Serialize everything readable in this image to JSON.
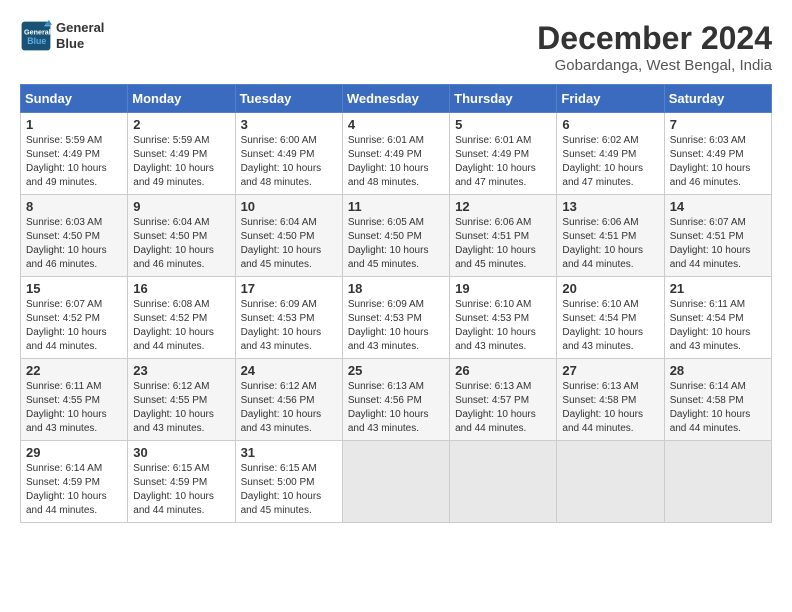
{
  "header": {
    "logo_line1": "General",
    "logo_line2": "Blue",
    "title": "December 2024",
    "location": "Gobardanga, West Bengal, India"
  },
  "weekdays": [
    "Sunday",
    "Monday",
    "Tuesday",
    "Wednesday",
    "Thursday",
    "Friday",
    "Saturday"
  ],
  "weeks": [
    [
      {
        "day": "1",
        "sunrise": "5:59 AM",
        "sunset": "4:49 PM",
        "daylight": "10 hours and 49 minutes."
      },
      {
        "day": "2",
        "sunrise": "5:59 AM",
        "sunset": "4:49 PM",
        "daylight": "10 hours and 49 minutes."
      },
      {
        "day": "3",
        "sunrise": "6:00 AM",
        "sunset": "4:49 PM",
        "daylight": "10 hours and 48 minutes."
      },
      {
        "day": "4",
        "sunrise": "6:01 AM",
        "sunset": "4:49 PM",
        "daylight": "10 hours and 48 minutes."
      },
      {
        "day": "5",
        "sunrise": "6:01 AM",
        "sunset": "4:49 PM",
        "daylight": "10 hours and 47 minutes."
      },
      {
        "day": "6",
        "sunrise": "6:02 AM",
        "sunset": "4:49 PM",
        "daylight": "10 hours and 47 minutes."
      },
      {
        "day": "7",
        "sunrise": "6:03 AM",
        "sunset": "4:49 PM",
        "daylight": "10 hours and 46 minutes."
      }
    ],
    [
      {
        "day": "8",
        "sunrise": "6:03 AM",
        "sunset": "4:50 PM",
        "daylight": "10 hours and 46 minutes."
      },
      {
        "day": "9",
        "sunrise": "6:04 AM",
        "sunset": "4:50 PM",
        "daylight": "10 hours and 46 minutes."
      },
      {
        "day": "10",
        "sunrise": "6:04 AM",
        "sunset": "4:50 PM",
        "daylight": "10 hours and 45 minutes."
      },
      {
        "day": "11",
        "sunrise": "6:05 AM",
        "sunset": "4:50 PM",
        "daylight": "10 hours and 45 minutes."
      },
      {
        "day": "12",
        "sunrise": "6:06 AM",
        "sunset": "4:51 PM",
        "daylight": "10 hours and 45 minutes."
      },
      {
        "day": "13",
        "sunrise": "6:06 AM",
        "sunset": "4:51 PM",
        "daylight": "10 hours and 44 minutes."
      },
      {
        "day": "14",
        "sunrise": "6:07 AM",
        "sunset": "4:51 PM",
        "daylight": "10 hours and 44 minutes."
      }
    ],
    [
      {
        "day": "15",
        "sunrise": "6:07 AM",
        "sunset": "4:52 PM",
        "daylight": "10 hours and 44 minutes."
      },
      {
        "day": "16",
        "sunrise": "6:08 AM",
        "sunset": "4:52 PM",
        "daylight": "10 hours and 44 minutes."
      },
      {
        "day": "17",
        "sunrise": "6:09 AM",
        "sunset": "4:53 PM",
        "daylight": "10 hours and 43 minutes."
      },
      {
        "day": "18",
        "sunrise": "6:09 AM",
        "sunset": "4:53 PM",
        "daylight": "10 hours and 43 minutes."
      },
      {
        "day": "19",
        "sunrise": "6:10 AM",
        "sunset": "4:53 PM",
        "daylight": "10 hours and 43 minutes."
      },
      {
        "day": "20",
        "sunrise": "6:10 AM",
        "sunset": "4:54 PM",
        "daylight": "10 hours and 43 minutes."
      },
      {
        "day": "21",
        "sunrise": "6:11 AM",
        "sunset": "4:54 PM",
        "daylight": "10 hours and 43 minutes."
      }
    ],
    [
      {
        "day": "22",
        "sunrise": "6:11 AM",
        "sunset": "4:55 PM",
        "daylight": "10 hours and 43 minutes."
      },
      {
        "day": "23",
        "sunrise": "6:12 AM",
        "sunset": "4:55 PM",
        "daylight": "10 hours and 43 minutes."
      },
      {
        "day": "24",
        "sunrise": "6:12 AM",
        "sunset": "4:56 PM",
        "daylight": "10 hours and 43 minutes."
      },
      {
        "day": "25",
        "sunrise": "6:13 AM",
        "sunset": "4:56 PM",
        "daylight": "10 hours and 43 minutes."
      },
      {
        "day": "26",
        "sunrise": "6:13 AM",
        "sunset": "4:57 PM",
        "daylight": "10 hours and 44 minutes."
      },
      {
        "day": "27",
        "sunrise": "6:13 AM",
        "sunset": "4:58 PM",
        "daylight": "10 hours and 44 minutes."
      },
      {
        "day": "28",
        "sunrise": "6:14 AM",
        "sunset": "4:58 PM",
        "daylight": "10 hours and 44 minutes."
      }
    ],
    [
      {
        "day": "29",
        "sunrise": "6:14 AM",
        "sunset": "4:59 PM",
        "daylight": "10 hours and 44 minutes."
      },
      {
        "day": "30",
        "sunrise": "6:15 AM",
        "sunset": "4:59 PM",
        "daylight": "10 hours and 44 minutes."
      },
      {
        "day": "31",
        "sunrise": "6:15 AM",
        "sunset": "5:00 PM",
        "daylight": "10 hours and 45 minutes."
      },
      null,
      null,
      null,
      null
    ]
  ]
}
